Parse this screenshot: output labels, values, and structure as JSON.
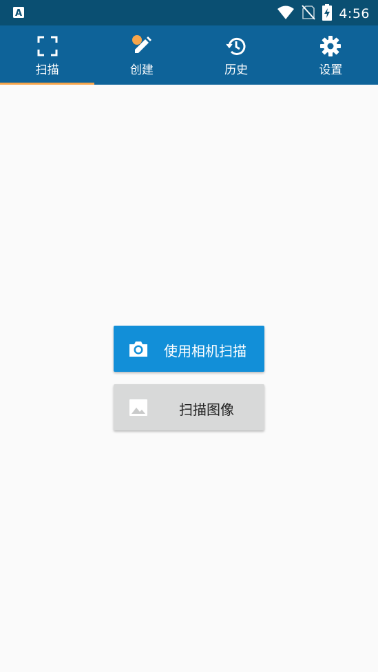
{
  "status_bar": {
    "time": "4:56",
    "icons": [
      "app-notification-icon",
      "wifi-icon",
      "no-sim-icon",
      "battery-charging-icon"
    ]
  },
  "tabs": [
    {
      "label": "扫描",
      "icon": "scan-frame-icon",
      "active": true
    },
    {
      "label": "创建",
      "icon": "pencil-icon",
      "active": false
    },
    {
      "label": "历史",
      "icon": "history-icon",
      "active": false
    },
    {
      "label": "设置",
      "icon": "gear-icon",
      "active": false
    }
  ],
  "buttons": {
    "camera_scan": {
      "label": "使用相机扫描",
      "icon": "camera-icon"
    },
    "image_scan": {
      "label": "扫描图像",
      "icon": "image-icon"
    }
  },
  "colors": {
    "status_bar": "#0a4f72",
    "toolbar": "#0e6399",
    "active_tab_indicator": "#f7a54a",
    "primary_button": "#128fd8",
    "secondary_button": "#d8d9d9",
    "background": "#fafafa"
  }
}
